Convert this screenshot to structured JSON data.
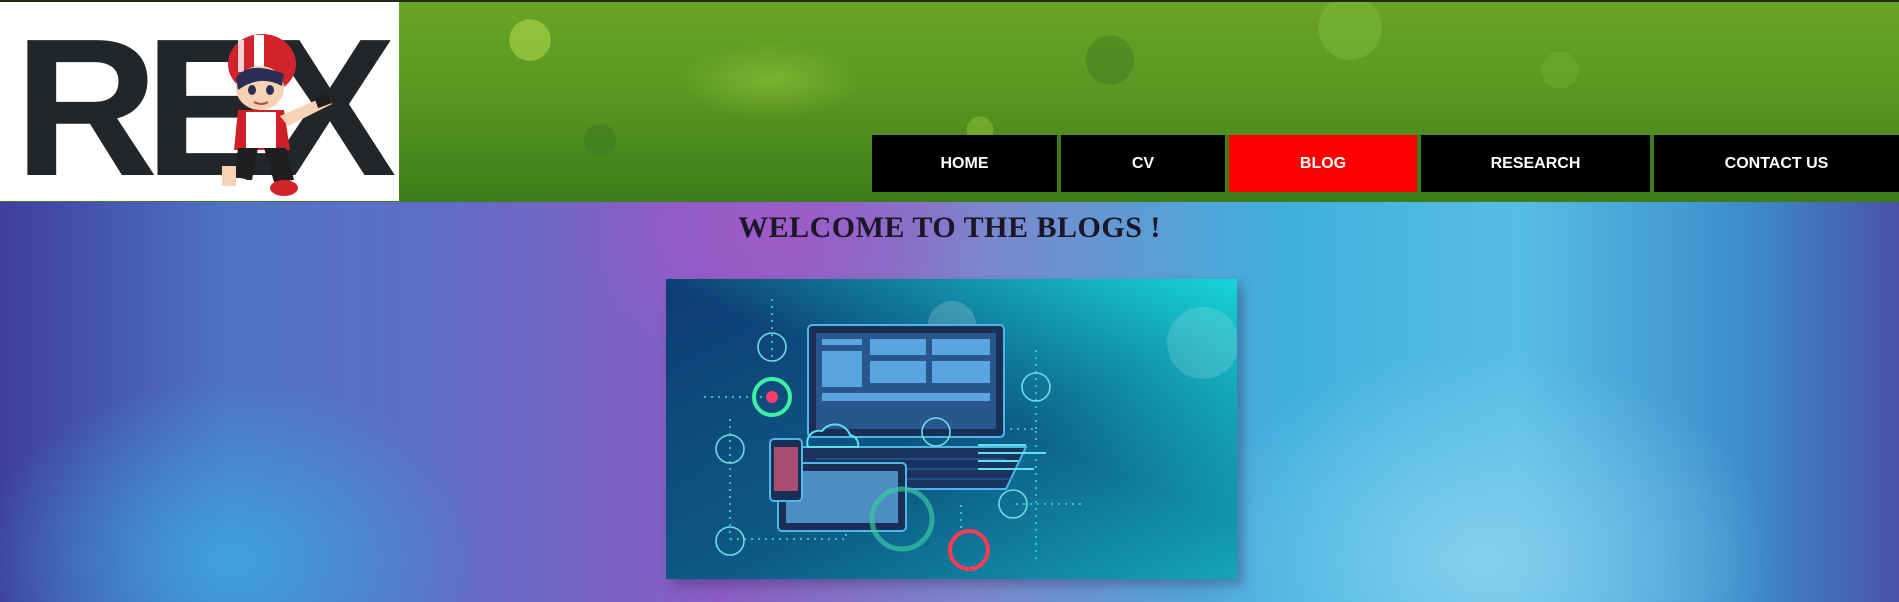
{
  "site": {
    "logo_text": "REX",
    "logo_icon": "rex-mascot-logo"
  },
  "nav": {
    "items": [
      {
        "label": "HOME",
        "active": false
      },
      {
        "label": "CV",
        "active": false
      },
      {
        "label": "BLOG",
        "active": true
      },
      {
        "label": "RESEARCH",
        "active": false
      },
      {
        "label": "CONTACT US",
        "active": false
      }
    ],
    "active_color": "#ff0000",
    "item_color": "#000000"
  },
  "main": {
    "heading": "WELCOME TO THE BLOGS !",
    "hero_image": "technology-devices-network-illustration"
  },
  "colors": {
    "header_green": "#5a9722",
    "page_gradient_purple": "#8b5cc3",
    "page_gradient_blue": "#3fb0de"
  }
}
